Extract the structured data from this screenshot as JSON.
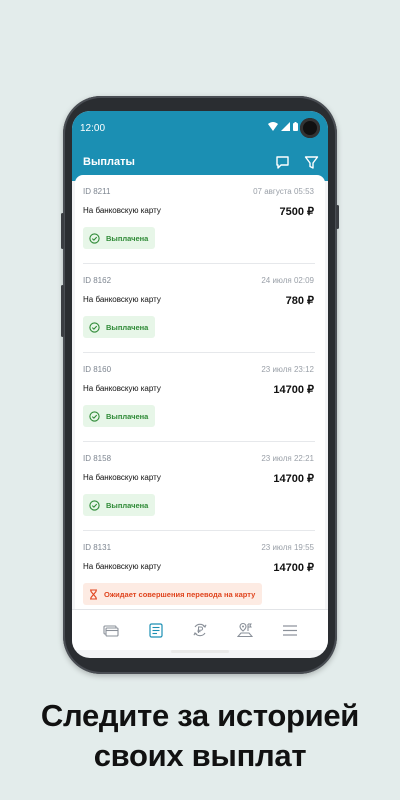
{
  "status_bar": {
    "time": "12:00"
  },
  "app_bar": {
    "title": "Выплаты"
  },
  "payouts": [
    {
      "id": "ID 8211",
      "date": "07 августа 05:53",
      "method": "На банковскую карту",
      "amount": "7500 ₽",
      "status": "Выплачена",
      "status_type": "paid"
    },
    {
      "id": "ID 8162",
      "date": "24 июля 02:09",
      "method": "На банковскую карту",
      "amount": "780 ₽",
      "status": "Выплачена",
      "status_type": "paid"
    },
    {
      "id": "ID 8160",
      "date": "23 июля 23:12",
      "method": "На банковскую карту",
      "amount": "14700 ₽",
      "status": "Выплачена",
      "status_type": "paid"
    },
    {
      "id": "ID 8158",
      "date": "23 июля 22:21",
      "method": "На банковскую карту",
      "amount": "14700 ₽",
      "status": "Выплачена",
      "status_type": "paid"
    },
    {
      "id": "ID 8131",
      "date": "23 июля 19:55",
      "method": "На банковскую карту",
      "amount": "14700 ₽",
      "status": "Ожидает совершения перевода на карту",
      "status_type": "pending"
    }
  ],
  "bottom_nav": [
    {
      "name": "cards",
      "icon": "credit-card-icon"
    },
    {
      "name": "payouts",
      "icon": "receipt-list-icon",
      "active": true
    },
    {
      "name": "exchange",
      "icon": "ruble-exchange-icon"
    },
    {
      "name": "map",
      "icon": "map-pin-icon"
    },
    {
      "name": "menu",
      "icon": "hamburger-menu-icon"
    }
  ],
  "colors": {
    "primary": "#1b8fb3",
    "paid": "#2e8a36",
    "pending": "#e0451f"
  },
  "caption": {
    "line1": "Следите за историей",
    "line2": "своих выплат"
  }
}
